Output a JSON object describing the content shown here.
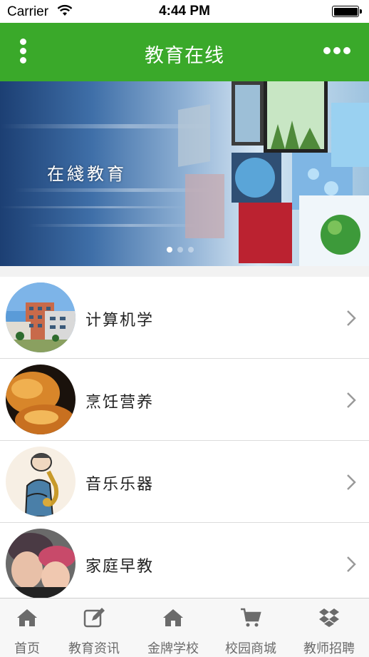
{
  "status_bar": {
    "carrier": "Carrier",
    "time": "4:44 PM"
  },
  "header": {
    "title": "教育在线"
  },
  "banner": {
    "text": "在綫教育",
    "slide_count": 3,
    "active_slide": 1
  },
  "list": {
    "items": [
      {
        "label": "计算机学",
        "icon": "building-photo"
      },
      {
        "label": "烹饪营养",
        "icon": "bread-photo"
      },
      {
        "label": "音乐乐器",
        "icon": "saxophone-player-drawing"
      },
      {
        "label": "家庭早教",
        "icon": "mother-child-photo"
      }
    ]
  },
  "tab_bar": {
    "tabs": [
      {
        "label": "首页",
        "icon": "home-icon"
      },
      {
        "label": "教育资讯",
        "icon": "edit-icon"
      },
      {
        "label": "金牌学校",
        "icon": "home-icon"
      },
      {
        "label": "校园商城",
        "icon": "cart-icon"
      },
      {
        "label": "教师招聘",
        "icon": "dropbox-icon"
      }
    ]
  },
  "colors": {
    "accent": "#3aa92a",
    "tab_label": "#6b6b6b",
    "background": "#f2f2f2"
  }
}
